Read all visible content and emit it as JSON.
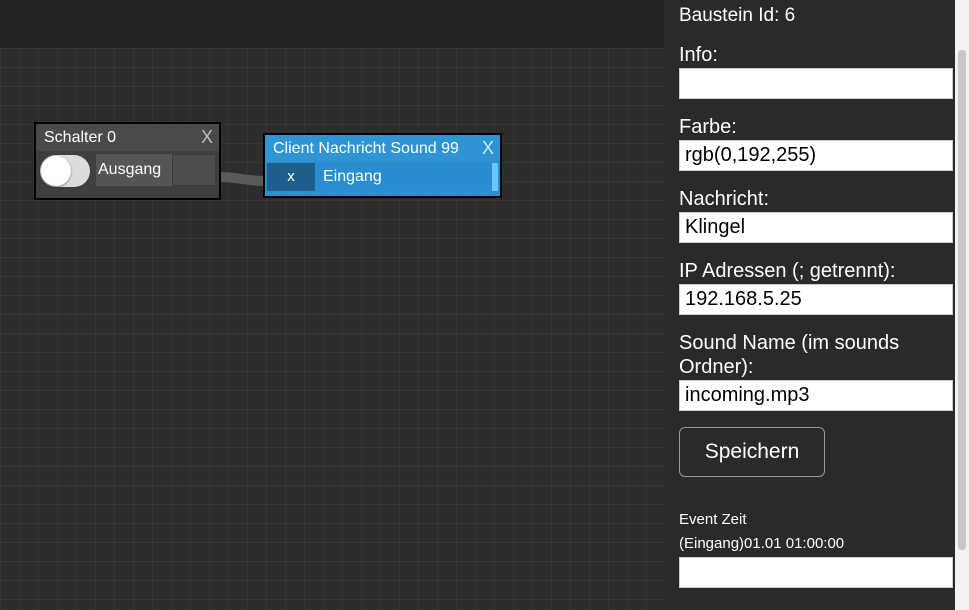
{
  "canvas": {
    "nodes": {
      "switch": {
        "title": "Schalter 0",
        "close": "X",
        "output_label": "Ausgang"
      },
      "sound": {
        "title": "Client Nachricht Sound 99",
        "close": "X",
        "input_button": "x",
        "input_label": "Eingang"
      }
    }
  },
  "panel": {
    "block_id": "Baustein Id: 6",
    "fields": {
      "info": {
        "label": "Info:",
        "value": ""
      },
      "color": {
        "label": "Farbe:",
        "value": "rgb(0,192,255)"
      },
      "message": {
        "label": "Nachricht:",
        "value": "Klingel"
      },
      "ip": {
        "label": "IP Adressen (; getrennt):",
        "value": "192.168.5.25"
      },
      "sound": {
        "label_line1": "Sound Name (im sounds",
        "label_line2": "Ordner):",
        "value": "incoming.mp3"
      }
    },
    "save_label": "Speichern",
    "event_title": "Event Zeit",
    "event_entry": "(Eingang)01.01 01:00:00",
    "event_value": ""
  },
  "colors": {
    "node_blue": "#2a8fd0",
    "node_gray": "#3f3f3f",
    "canvas_bg": "#2d2d2d",
    "panel_bg": "#2a2a2a"
  }
}
